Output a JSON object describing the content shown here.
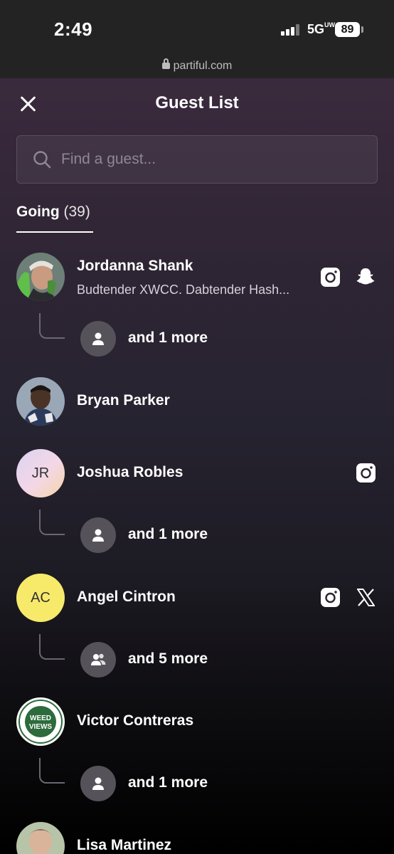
{
  "status_bar": {
    "time": "2:49",
    "network": "5G",
    "network_badge": "UW",
    "battery": "89",
    "url": "partiful.com"
  },
  "header": {
    "title": "Guest List",
    "close_icon": "close-icon"
  },
  "search": {
    "placeholder": "Find a guest...",
    "value": ""
  },
  "tab": {
    "label": "Going",
    "count": "(39)"
  },
  "guests": [
    {
      "name": "Jordanna Shank",
      "bio": "Budtender XWCC. Dabtender Hash...",
      "avatar_type": "photo",
      "socials": [
        "instagram-icon",
        "snapchat-icon"
      ],
      "plus_ones": "and 1 more"
    },
    {
      "name": "Bryan Parker",
      "avatar_type": "photo",
      "socials": [],
      "plus_ones": ""
    },
    {
      "name": "Joshua Robles",
      "initials": "JR",
      "avatar_type": "initials",
      "socials": [
        "instagram-icon"
      ],
      "plus_ones": "and 1 more"
    },
    {
      "name": "Angel Cintron",
      "initials": "AC",
      "avatar_type": "initials",
      "avatar_color": "#f7ea6b",
      "socials": [
        "instagram-icon",
        "x-icon"
      ],
      "plus_ones": "and 5 more"
    },
    {
      "name": "Victor Contreras",
      "avatar_type": "logo",
      "avatar_logo_text": "WEED VIEWS",
      "socials": [],
      "plus_ones": "and 1 more"
    },
    {
      "name": "Lisa Martinez",
      "avatar_type": "photo",
      "socials": [],
      "plus_ones": ""
    }
  ]
}
